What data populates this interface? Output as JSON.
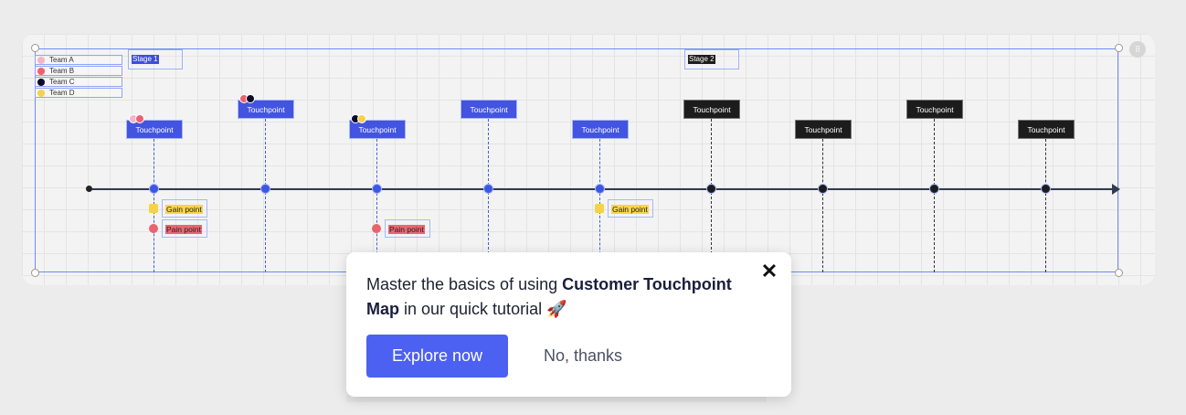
{
  "board": {
    "legend": [
      {
        "label": "Team A",
        "color": "#f4b6c4"
      },
      {
        "label": "Team B",
        "color": "#e9636f"
      },
      {
        "label": "Team C",
        "color": "#0b0b2b"
      },
      {
        "label": "Team D",
        "color": "#f5d24a"
      }
    ],
    "stages": [
      {
        "label": "Stage 1",
        "bg": "#3c4fd6"
      },
      {
        "label": "Stage 2",
        "bg": "#1c1c1c"
      }
    ],
    "touchpoints": [
      {
        "label": "Touchpoint",
        "style": "blue"
      },
      {
        "label": "Touchpoint",
        "style": "blue"
      },
      {
        "label": "Touchpoint",
        "style": "blue"
      },
      {
        "label": "Touchpoint",
        "style": "blue"
      },
      {
        "label": "Touchpoint",
        "style": "blue"
      },
      {
        "label": "Touchpoint",
        "style": "black"
      },
      {
        "label": "Touchpoint",
        "style": "black"
      },
      {
        "label": "Touchpoint",
        "style": "black"
      },
      {
        "label": "Touchpoint",
        "style": "black"
      }
    ],
    "gain_label": "Gain point",
    "pain_label": "Pain point",
    "grip_icon": "drag-grip-icon"
  },
  "popup": {
    "text_before": "Master the basics of using ",
    "text_bold": "Customer Touchpoint Map",
    "text_after": " in our quick tutorial",
    "emoji": "🚀",
    "close_icon": "✕",
    "explore_label": "Explore now",
    "nothanks_label": "No, thanks",
    "accent": "#4c60f2"
  }
}
